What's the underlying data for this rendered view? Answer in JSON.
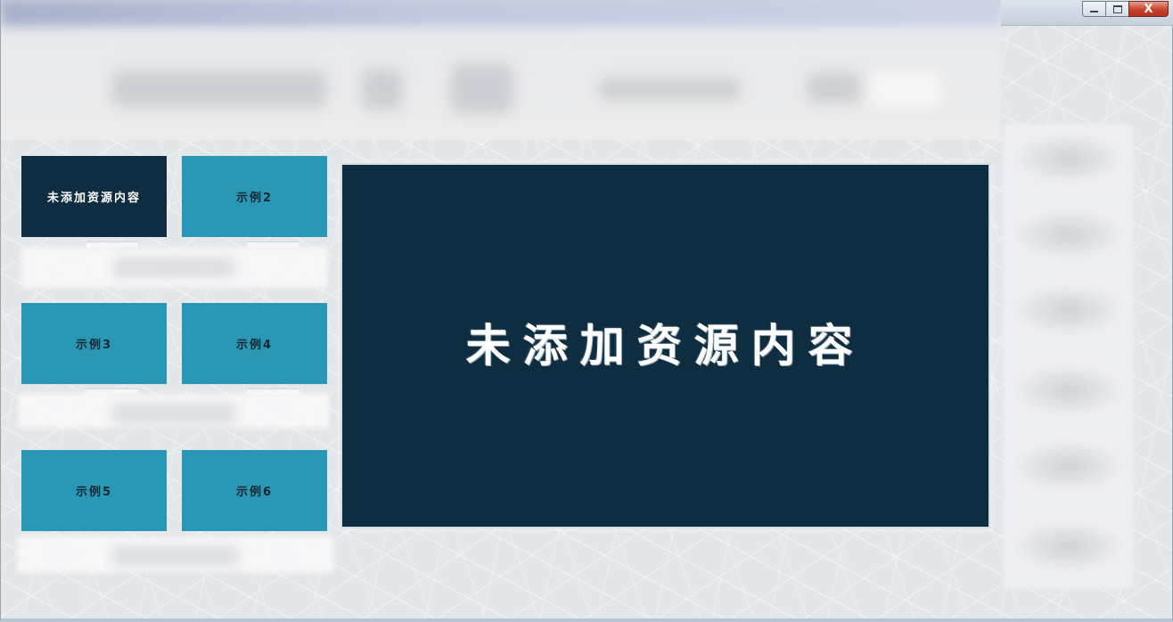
{
  "window": {
    "caption_buttons": {
      "minimize_icon": "minimize-icon",
      "maximize_icon": "maximize-icon",
      "close_glyph": "X"
    }
  },
  "tiles": [
    {
      "label": "未添加资源内容",
      "active": true
    },
    {
      "label": "示例2",
      "active": false
    },
    {
      "label": "示例3",
      "active": false
    },
    {
      "label": "示例4",
      "active": false
    },
    {
      "label": "示例5",
      "active": false
    },
    {
      "label": "示例6",
      "active": false
    }
  ],
  "preview": {
    "text": "未添加资源内容"
  },
  "colors": {
    "tile_active": "#0f2d41",
    "tile_default": "#2a98b5",
    "preview_bg": "#0f2d41"
  }
}
